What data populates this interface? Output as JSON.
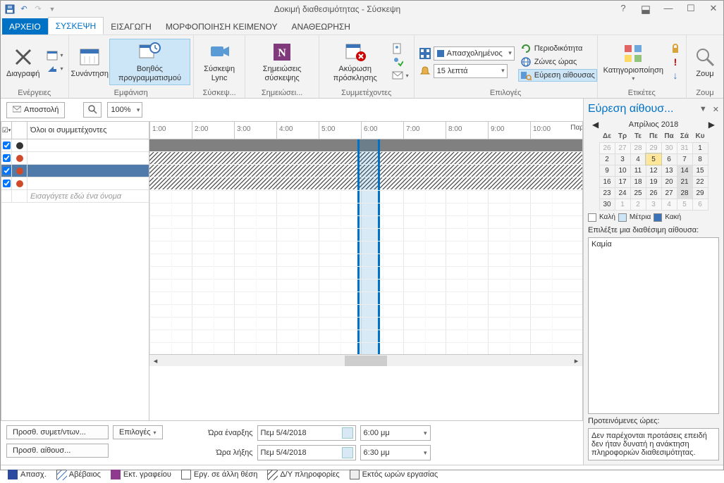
{
  "titlebar": {
    "title": "Δοκιμή διαθεσιμότητας - Σύσκεψη"
  },
  "tabs": {
    "file": "ΑΡΧΕΙΟ",
    "meeting": "ΣΥΣΚΕΨΗ",
    "insert": "ΕΙΣΑΓΩΓΗ",
    "format": "ΜΟΡΦΟΠΟΙΗΣΗ ΚΕΙΜΕΝΟΥ",
    "review": "ΑΝΑΘΕΩΡΗΣΗ"
  },
  "ribbon": {
    "actions": {
      "label": "Ενέργειες",
      "delete": "Διαγραφή"
    },
    "appearance": {
      "label": "Εμφάνιση",
      "appt": "Συνάντηση",
      "assistant": "Βοηθός προγραμματισμού"
    },
    "lync": {
      "label": "Σύσκεψ...",
      "btn": "Σύσκεψη Lync"
    },
    "notes": {
      "label": "Σημειώσει...",
      "btn": "Σημειώσεις σύσκεψης"
    },
    "attendees": {
      "label": "Συμμετέχοντες",
      "btn": "Ακύρωση πρόσκλησης"
    },
    "options": {
      "label": "Επιλογές",
      "showas": "Απασχολημένος",
      "reminder": "15 λεπτά",
      "recurrence": "Περιοδικότητα",
      "timezones": "Ζώνες ώρας",
      "roomfinder": "Εύρεση αίθουσας"
    },
    "tags": {
      "label": "Ετικέτες",
      "cat": "Κατηγοριοποίηση"
    },
    "zoom": {
      "label": "Ζουμ",
      "btn": "Ζουμ"
    }
  },
  "ctrl": {
    "send": "Αποστολή",
    "zoom": "100%"
  },
  "sched": {
    "header": "Όλοι οι συμμετέχοντες",
    "placeholder": "Εισαγάγετε εδώ ένα όνομα",
    "hours": [
      "1:00",
      "2:00",
      "3:00",
      "4:00",
      "5:00",
      "6:00",
      "7:00",
      "8:00",
      "9:00",
      "10:00"
    ],
    "par": "Παρ"
  },
  "bottom": {
    "add_att": "Προσθ. συμετ/ντων...",
    "options": "Επιλογές",
    "add_room": "Προσθ. αίθουσ...",
    "start_l": "Ώρα έναρξης",
    "end_l": "Ώρα λήξης",
    "date": "Πεμ 5/4/2018",
    "t_start": "6:00 μμ",
    "t_end": "6:30 μμ"
  },
  "legend": {
    "busy": "Απασχ.",
    "tent": "Αβέβαιος",
    "oof": "Εκτ. γραφείου",
    "else": "Εργ. σε άλλη θέση",
    "noinfo": "Δ/Υ πληροφορίες",
    "outside": "Εκτός ωρών εργασίας"
  },
  "roomfinder": {
    "title": "Εύρεση αίθουσ...",
    "month": "Απρίλιος 2018",
    "dow": [
      "Δε",
      "Τρ",
      "Τε",
      "Πε",
      "Πα",
      "Σά",
      "Κυ"
    ],
    "weeks": [
      [
        {
          "n": 26,
          "d": 1
        },
        {
          "n": 27,
          "d": 1
        },
        {
          "n": 28,
          "d": 1
        },
        {
          "n": 29,
          "d": 1
        },
        {
          "n": 30,
          "d": 1
        },
        {
          "n": 31,
          "d": 1
        },
        {
          "n": 1
        }
      ],
      [
        {
          "n": 2
        },
        {
          "n": 3
        },
        {
          "n": 4
        },
        {
          "n": 5,
          "s": 1
        },
        {
          "n": 6
        },
        {
          "n": 7
        },
        {
          "n": 8
        }
      ],
      [
        {
          "n": 9
        },
        {
          "n": 10
        },
        {
          "n": 11
        },
        {
          "n": 12
        },
        {
          "n": 13
        },
        {
          "n": 14,
          "h": 1
        },
        {
          "n": 15
        }
      ],
      [
        {
          "n": 16
        },
        {
          "n": 17
        },
        {
          "n": 18
        },
        {
          "n": 19
        },
        {
          "n": 20
        },
        {
          "n": 21,
          "h": 1
        },
        {
          "n": 22
        }
      ],
      [
        {
          "n": 23
        },
        {
          "n": 24
        },
        {
          "n": 25
        },
        {
          "n": 26
        },
        {
          "n": 27
        },
        {
          "n": 28,
          "h": 1
        },
        {
          "n": 29
        }
      ],
      [
        {
          "n": 30
        },
        {
          "n": 1,
          "d": 1
        },
        {
          "n": 2,
          "d": 1
        },
        {
          "n": 3,
          "d": 1
        },
        {
          "n": 4,
          "d": 1
        },
        {
          "n": 5,
          "d": 1
        },
        {
          "n": 6,
          "d": 1
        }
      ]
    ],
    "good": "Καλή",
    "mid": "Μέτρια",
    "bad": "Κακή",
    "choose": "Επιλέξτε μια διαθέσιμη αίθουσα:",
    "none": "Καμία",
    "suggested": "Προτεινόμενες ώρες:",
    "suggest_msg": "Δεν παρέχονται προτάσεις επειδή δεν ήταν δυνατή η ανάκτηση πληροφοριών διαθεσιμότητας."
  }
}
